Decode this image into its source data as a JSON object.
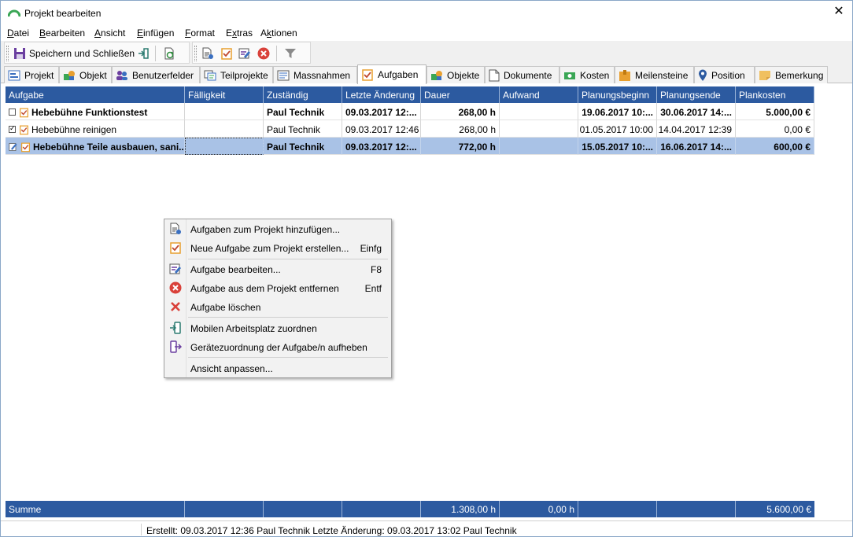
{
  "window": {
    "title": "Projekt bearbeiten",
    "close_glyph": "✕"
  },
  "menu": {
    "items": [
      "Datei",
      "Bearbeiten",
      "Ansicht",
      "Einfügen",
      "Format",
      "Extras",
      "Aktionen"
    ],
    "mnemonics": [
      "D",
      "B",
      "A",
      "E",
      "F",
      "x",
      "k"
    ]
  },
  "toolbar": {
    "save_close_label": "Speichern und Schließen",
    "icons": [
      "save-icon",
      "exit-icon",
      "refresh-icon",
      "add-tasks-icon",
      "new-task-icon",
      "edit-task-icon",
      "remove-icon",
      "filter-icon"
    ]
  },
  "tabs": [
    {
      "label": "Projekt",
      "icon": "project-icon"
    },
    {
      "label": "Objekt",
      "icon": "object-icon"
    },
    {
      "label": "Benutzerfelder",
      "icon": "userfields-icon"
    },
    {
      "label": "Teilprojekte",
      "icon": "subprojects-icon"
    },
    {
      "label": "Massnahmen",
      "icon": "measures-icon"
    },
    {
      "label": "Aufgaben",
      "icon": "tasks-icon",
      "active": true
    },
    {
      "label": "Objekte",
      "icon": "objects-icon"
    },
    {
      "label": "Dokumente",
      "icon": "documents-icon"
    },
    {
      "label": "Kosten",
      "icon": "costs-icon"
    },
    {
      "label": "Meilensteine",
      "icon": "milestones-icon"
    },
    {
      "label": "Position",
      "icon": "position-icon"
    },
    {
      "label": "Bemerkung",
      "icon": "note-icon"
    }
  ],
  "grid": {
    "columns": [
      "Aufgabe",
      "Fälligkeit",
      "Zuständig",
      "Letzte Änderung",
      "Dauer",
      "Aufwand",
      "Planungsbeginn",
      "Planungsende",
      "Plankosten"
    ],
    "rows": [
      {
        "aufgabe": "Hebebühne Funktionstest",
        "faelligkeit": "",
        "zustaendig": "Paul Technik",
        "letzte_aenderung": "09.03.2017 12:...",
        "dauer": "268,00 h",
        "aufwand": "",
        "planungsbeginn": "19.06.2017 10:...",
        "planungsende": "30.06.2017 14:...",
        "plankosten": "5.000,00 €"
      },
      {
        "aufgabe": "Hebebühne reinigen",
        "faelligkeit": "",
        "zustaendig": "Paul Technik",
        "letzte_aenderung": "09.03.2017 12:46",
        "dauer": "268,00 h",
        "aufwand": "",
        "planungsbeginn": "01.05.2017 10:00",
        "planungsende": "14.04.2017 12:39",
        "plankosten": "0,00 €"
      },
      {
        "aufgabe": "Hebebühne Teile ausbauen, sani...",
        "faelligkeit": "",
        "zustaendig": "Paul Technik",
        "letzte_aenderung": "09.03.2017 12:...",
        "dauer": "772,00 h",
        "aufwand": "",
        "planungsbeginn": "15.05.2017 10:...",
        "planungsende": "16.06.2017 14:...",
        "plankosten": "600,00 €"
      }
    ],
    "summary": {
      "label": "Summe",
      "dauer": "1.308,00 h",
      "aufwand": "0,00 h",
      "plankosten": "5.600,00 €"
    }
  },
  "context_menu": {
    "items": [
      {
        "label": "Aufgaben zum Projekt hinzufügen...",
        "shortcut": "",
        "icon": "add-tasks-icon"
      },
      {
        "label": "Neue Aufgabe zum Projekt erstellen...",
        "shortcut": "Einfg",
        "icon": "new-task-icon"
      },
      {
        "label": "Aufgabe bearbeiten...",
        "shortcut": "F8",
        "icon": "edit-task-icon"
      },
      {
        "label": "Aufgabe aus dem Projekt entfernen",
        "shortcut": "Entf",
        "icon": "remove-circle-icon"
      },
      {
        "label": "Aufgabe löschen",
        "shortcut": "",
        "icon": "delete-x-icon"
      },
      {
        "label": "Mobilen Arbeitsplatz zuordnen",
        "shortcut": "",
        "icon": "assign-device-icon"
      },
      {
        "label": "Gerätezuordnung der Aufgabe/n aufheben",
        "shortcut": "",
        "icon": "unassign-device-icon"
      },
      {
        "label": "Ansicht anpassen...",
        "shortcut": "",
        "icon": ""
      }
    ]
  },
  "status": {
    "text": "Erstellt: 09.03.2017 12:36 Paul Technik  Letzte Änderung: 09.03.2017 13:02 Paul Technik"
  },
  "colors": {
    "header_blue": "#2c5aa0",
    "selection": "#a9c2e6",
    "remove_red": "#d9413a",
    "task_orange": "#e8a030"
  }
}
